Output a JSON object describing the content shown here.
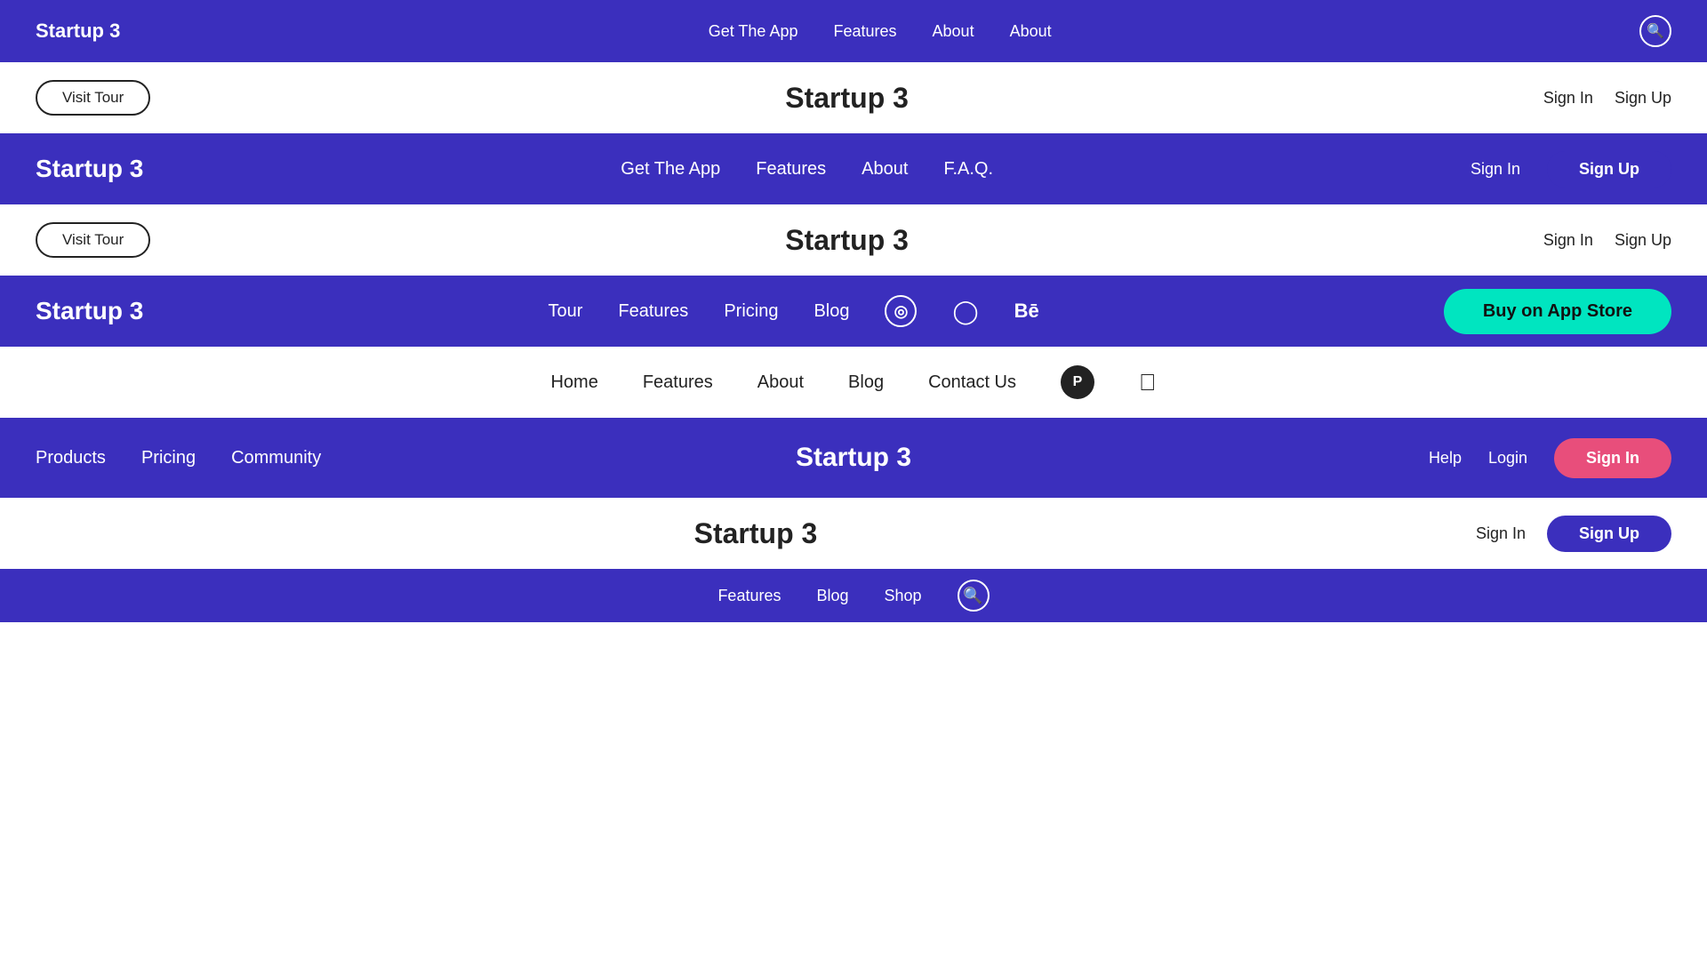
{
  "nav1": {
    "brand": "Startup 3",
    "links": [
      "Get The App",
      "Features",
      "About",
      "About"
    ],
    "search_icon": "🔍"
  },
  "band1": {
    "visit_tour": "Visit Tour",
    "title": "Startup 3",
    "sign_in": "Sign In",
    "sign_up": "Sign Up"
  },
  "nav2": {
    "brand": "Startup 3",
    "links": [
      "Get The App",
      "Features",
      "About",
      "F.A.Q."
    ],
    "sign_in": "Sign In",
    "sign_up": "Sign Up"
  },
  "band2": {
    "visit_tour": "Visit Tour",
    "title": "Startup 3",
    "sign_in": "Sign In",
    "sign_up": "Sign Up"
  },
  "nav3": {
    "brand": "Startup 3",
    "links": [
      "Tour",
      "Features",
      "Pricing",
      "Blog"
    ],
    "buy_btn": "Buy on App Store",
    "dribbble": "⊕",
    "instagram": "⊙",
    "behance": "Bē"
  },
  "band3": {
    "links": [
      "Home",
      "Features",
      "About",
      "Blog",
      "Contact Us"
    ],
    "product_icon": "P",
    "apple_icon": "🍎"
  },
  "nav4": {
    "brand": "Startup 3",
    "links": [
      "Products",
      "Pricing",
      "Community"
    ],
    "title": "Startup 3",
    "help": "Help",
    "login": "Login",
    "sign_in": "Sign In"
  },
  "band4": {
    "title": "Startup 3",
    "sign_in": "Sign In",
    "sign_up": "Sign Up",
    "links": [
      "Features",
      "Blog",
      "Shop"
    ],
    "search": "🔍"
  },
  "pricing_label": "Pricing"
}
